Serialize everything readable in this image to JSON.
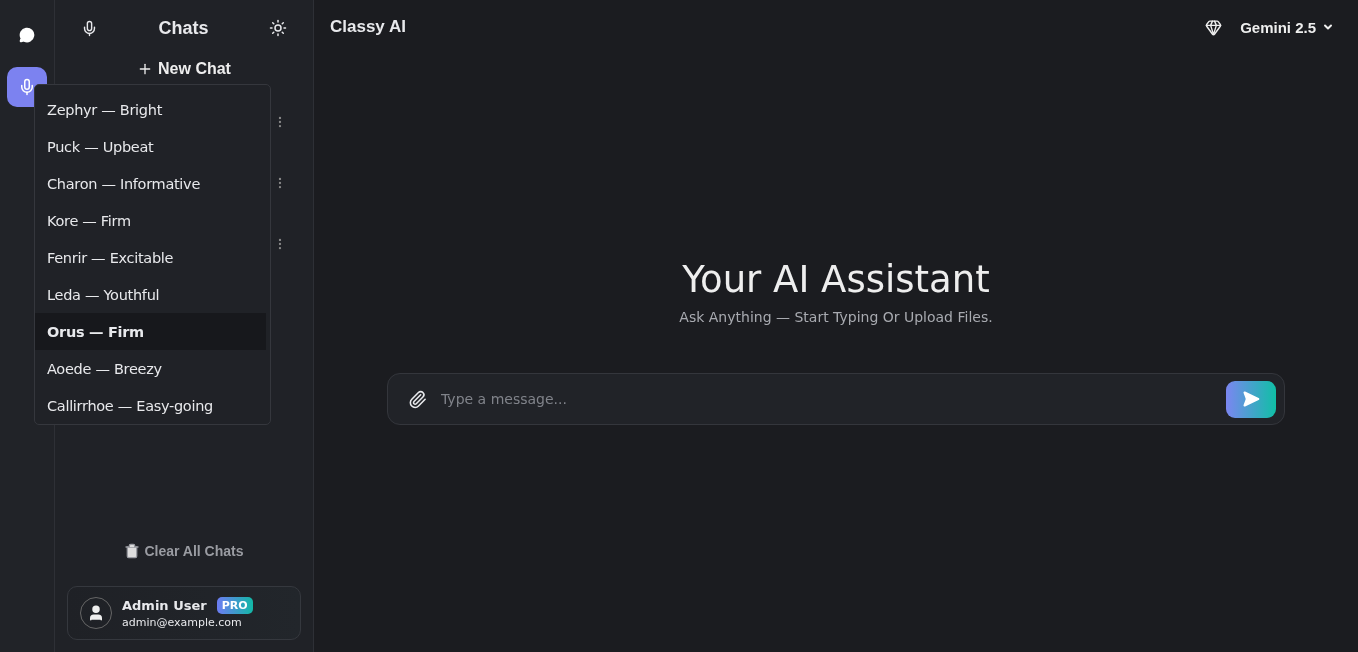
{
  "rail": {
    "items": [
      {
        "kind": "chat",
        "selected": false
      },
      {
        "kind": "voice",
        "selected": true
      }
    ]
  },
  "sidebar": {
    "title": "Chats",
    "new_chat": "New Chat",
    "clear": "Clear All Chats",
    "user": {
      "name": "Admin User",
      "badge": "PRO",
      "email": "admin@example.com"
    }
  },
  "voice_menu": {
    "items": [
      {
        "label": "Zephyr — Bright",
        "selected": false
      },
      {
        "label": "Puck — Upbeat",
        "selected": false
      },
      {
        "label": "Charon — Informative",
        "selected": false
      },
      {
        "label": "Kore — Firm",
        "selected": false
      },
      {
        "label": "Fenrir — Excitable",
        "selected": false
      },
      {
        "label": "Leda — Youthful",
        "selected": false
      },
      {
        "label": "Orus — Firm",
        "selected": true
      },
      {
        "label": "Aoede — Breezy",
        "selected": false
      },
      {
        "label": "Callirrhoe — Easy-going",
        "selected": false
      }
    ]
  },
  "header": {
    "title": "Classy AI",
    "model": "Gemini 2.5"
  },
  "hero": {
    "title": "Your AI Assistant",
    "subtitle": "Ask Anything — Start Typing Or Upload Files."
  },
  "composer": {
    "placeholder": "Type a message..."
  }
}
